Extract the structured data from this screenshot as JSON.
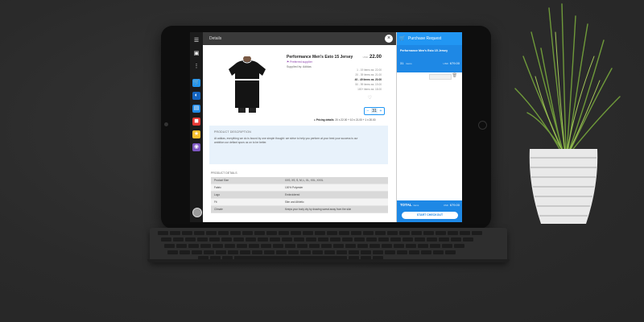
{
  "header": {
    "title": "Details"
  },
  "product": {
    "title": "Performance Men's Esto 15 Jersey",
    "badge": "Preferred supplier",
    "supplier": "Supplied by: Adidas",
    "price_currency": "USD",
    "price": "22.00",
    "tiers": [
      "1 - 19 items ea. 22.00",
      "20 - 39 items ea. 21.00",
      "40 - 49 items ea. 20.00",
      "50 - 99 items ea. 19.00",
      "100+ items ea. 18.00"
    ],
    "quantity": "31",
    "pricing_label": "Pricing details",
    "pricing_calc": "20 x 22.00 + 10 x 21.00 + 1 x 20.00"
  },
  "description": {
    "heading": "PRODUCT DESCRIPTION",
    "text": "At adidas, everything we do is bound by one simple thought: we strive to help you perform at your best your success is our ambition our defiant spurs us on to be better."
  },
  "details": {
    "heading": "PRODUCT DETAILS",
    "rows": [
      {
        "key": "Product Size",
        "value": "XXS, XS, S, M, L, XL, XXL, XXXL"
      },
      {
        "key": "Fabric",
        "value": "100% Polyester"
      },
      {
        "key": "Logo",
        "value": "Embroidered"
      },
      {
        "key": "Fit",
        "value": "Slim and Athletic"
      },
      {
        "key": "Climate",
        "value": "Keeps your body dry by drawing sweat away from the skin"
      }
    ]
  },
  "purchase": {
    "title": "Purchase Request",
    "item_name": "Performance Men's Esto 15 Jersey",
    "item_qty": "31",
    "item_qty_unit": "items",
    "item_currency": "USD",
    "item_price": "679.00",
    "total_label": "TOTAL",
    "total_sub": "items",
    "total_currency": "USD",
    "total_value": "679.00",
    "checkout_label": "START CHECKOUT"
  },
  "colors": {
    "accent": "#2196f3",
    "purple_badge": "#8e44ad"
  },
  "icons": [
    "menu-icon",
    "inbox-icon",
    "apps-icon",
    "cart-icon",
    "chart-icon",
    "document-icon",
    "archive-icon",
    "star-icon",
    "settings-icon",
    "trash-icon",
    "heart-icon",
    "close-icon"
  ]
}
